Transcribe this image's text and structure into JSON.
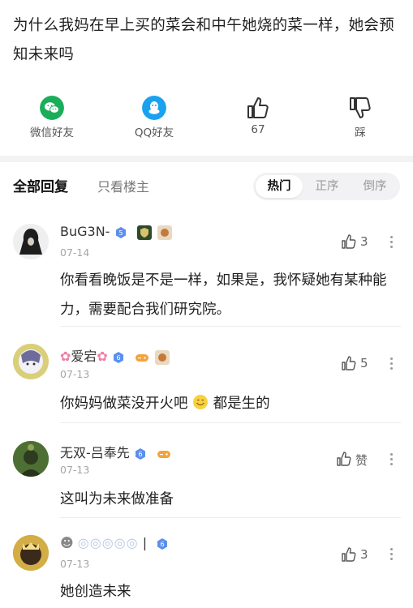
{
  "question": {
    "title": "为什么我妈在早上买的菜会和中午她烧的菜一样，她会预知未来吗"
  },
  "share": {
    "wechat_label": "微信好友",
    "qq_label": "QQ好友",
    "like_count": "67",
    "dislike_label": "踩"
  },
  "tabs": {
    "all_label": "全部回复",
    "op_label": "只看楼主",
    "sort": [
      "热门",
      "正序",
      "倒序"
    ]
  },
  "comments": [
    {
      "user": "BuG3N-",
      "date": "07-14",
      "likes": "3",
      "text": "你看看晚饭是不是一样，如果是，我怀疑她有某种能力，需要配合我们研究院。"
    },
    {
      "user": "爱宕",
      "date": "07-13",
      "likes": "5",
      "text_a": "你妈妈做菜没开火吧",
      "text_b": "都是生的"
    },
    {
      "user": "无双-吕奉先",
      "date": "07-13",
      "likes": "赞",
      "text": "这叫为未来做准备"
    },
    {
      "user": "|",
      "date": "07-13",
      "likes": "3",
      "text": "她创造未来"
    }
  ],
  "colors": {
    "wechat": "#1aad5a",
    "qq": "#1aa2f0",
    "accent_badge": "#3b7de8"
  }
}
